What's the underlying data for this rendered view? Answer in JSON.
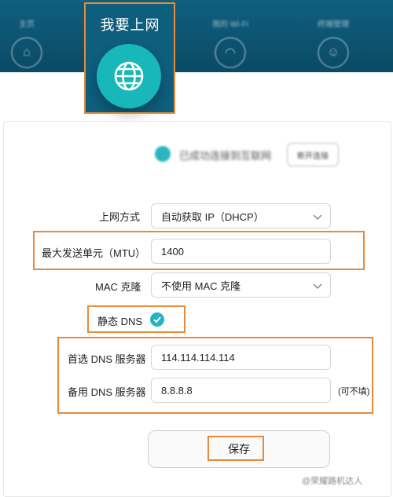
{
  "nav": {
    "items": [
      {
        "label": "主页",
        "icon": "home-icon"
      },
      {
        "label": "我要上网",
        "icon": "globe-icon"
      },
      {
        "label": "我的 Wi-Fi",
        "icon": "wifi-icon"
      },
      {
        "label": "终端管理",
        "icon": "user-icon"
      }
    ],
    "active_index": 1
  },
  "status": {
    "text": "已成功连接到互联网",
    "button_label": "断开连接"
  },
  "form": {
    "connection_mode": {
      "label": "上网方式",
      "value": "自动获取 IP（DHCP）"
    },
    "mtu": {
      "label": "最大发送单元（MTU）",
      "value": "1400"
    },
    "mac_clone": {
      "label": "MAC 克隆",
      "value": "不使用 MAC 克隆"
    },
    "static_dns": {
      "label": "静态 DNS",
      "checked": true
    },
    "primary_dns": {
      "label": "首选 DNS 服务器",
      "value": "114.114.114.114"
    },
    "secondary_dns": {
      "label": "备用 DNS 服务器",
      "value": "8.8.8.8",
      "note": "(可不填)"
    }
  },
  "save_label": "保存",
  "watermark": "@荣耀路机达人",
  "colors": {
    "header": "#0e5e7d",
    "accent": "#18b7b9",
    "highlight": "#e98a3b"
  }
}
